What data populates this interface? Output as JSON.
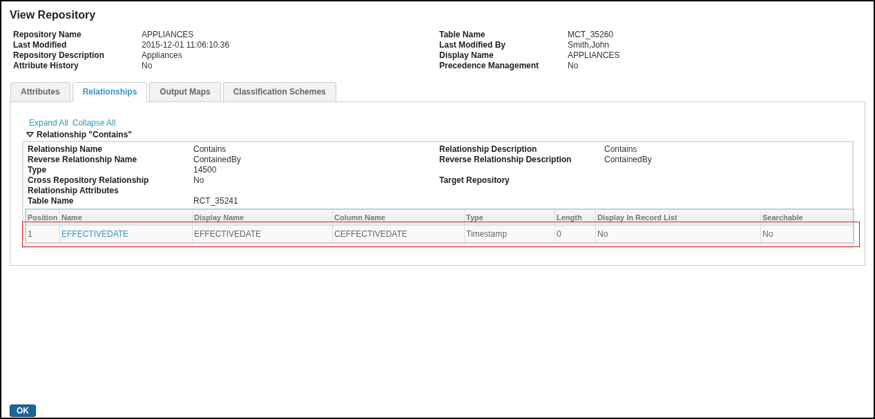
{
  "window": {
    "title": "View Repository"
  },
  "info": {
    "left": [
      {
        "label": "Repository Name",
        "value": "APPLIANCES"
      },
      {
        "label": "Last Modified",
        "value": "2015-12-01 11:06:10.36"
      },
      {
        "label": "Repository Description",
        "value": "Appliances"
      },
      {
        "label": "Attribute History",
        "value": "No"
      }
    ],
    "right": [
      {
        "label": "Table Name",
        "value": "MCT_35260"
      },
      {
        "label": "Last Modified By",
        "value": "Smith,John"
      },
      {
        "label": "Display Name",
        "value": "APPLIANCES"
      },
      {
        "label": "Precedence Management",
        "value": "No"
      }
    ]
  },
  "tabs": [
    {
      "label": "Attributes",
      "selected": false
    },
    {
      "label": "Relationships",
      "selected": true
    },
    {
      "label": "Output Maps",
      "selected": false
    },
    {
      "label": "Classification Schemes",
      "selected": false
    }
  ],
  "links": [
    "Expand All",
    "Collapse All"
  ],
  "relationship": {
    "title": "Relationship \"Contains\"",
    "expanded": true,
    "rows": [
      {
        "left": {
          "label": "Relationship Name",
          "value": "Contains"
        },
        "right": {
          "label": "Relationship Description",
          "value": "Contains"
        }
      },
      {
        "left": {
          "label": "Reverse Relationship Name",
          "value": "ContainedBy"
        },
        "right": {
          "label": "Reverse Relationship Description",
          "value": "ContainedBy"
        }
      },
      {
        "left": {
          "label": "Type",
          "value": "14500"
        }
      },
      {
        "left": {
          "label": "Cross Repository Relationship",
          "value": "No"
        },
        "right": {
          "label": "Target Repository"
        }
      },
      {
        "left": {
          "label": "Relationship Attributes"
        }
      },
      {
        "left": {
          "label": "Table Name",
          "value": "RCT_35241"
        }
      }
    ],
    "table": {
      "columns": [
        "Position",
        "Name",
        "Display Name",
        "Column Name",
        "Type",
        "Length",
        "Display In Record List",
        "Searchable"
      ],
      "rows": [
        {
          "highlighted": true,
          "cells": [
            "1",
            "EFFECTIVEDATE",
            "EFFECTIVEDATE",
            "CEFFECTIVEDATE",
            "Timestamp",
            "0",
            "No",
            "No"
          ]
        }
      ]
    }
  },
  "buttons": [
    "OK"
  ]
}
